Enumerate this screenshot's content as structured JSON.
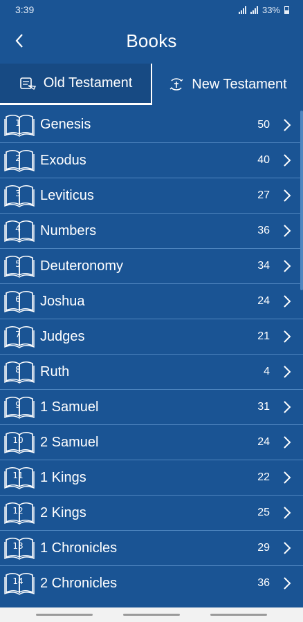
{
  "status": {
    "time": "3:39",
    "battery": "33%"
  },
  "header": {
    "title": "Books",
    "back_icon": "chevron-left-icon"
  },
  "tabs": [
    {
      "label": "Old Testament",
      "icon": "scroll-book-icon",
      "active": true
    },
    {
      "label": "New Testament",
      "icon": "cross-book-icon",
      "active": false
    }
  ],
  "books": [
    {
      "num": "1",
      "name": "Genesis",
      "chapters": "50"
    },
    {
      "num": "2",
      "name": "Exodus",
      "chapters": "40"
    },
    {
      "num": "3",
      "name": "Leviticus",
      "chapters": "27"
    },
    {
      "num": "4",
      "name": "Numbers",
      "chapters": "36"
    },
    {
      "num": "5",
      "name": "Deuteronomy",
      "chapters": "34"
    },
    {
      "num": "6",
      "name": "Joshua",
      "chapters": "24"
    },
    {
      "num": "7",
      "name": "Judges",
      "chapters": "21"
    },
    {
      "num": "8",
      "name": "Ruth",
      "chapters": "4"
    },
    {
      "num": "9",
      "name": "1 Samuel",
      "chapters": "31"
    },
    {
      "num": "10",
      "name": "2 Samuel",
      "chapters": "24"
    },
    {
      "num": "11",
      "name": "1 Kings",
      "chapters": "22"
    },
    {
      "num": "12",
      "name": "2 Kings",
      "chapters": "25"
    },
    {
      "num": "13",
      "name": "1 Chronicles",
      "chapters": "29"
    },
    {
      "num": "14",
      "name": "2 Chronicles",
      "chapters": "36"
    }
  ],
  "colors": {
    "background": "#1a5494",
    "divider": "#4f86c0",
    "text": "#ffffff"
  }
}
